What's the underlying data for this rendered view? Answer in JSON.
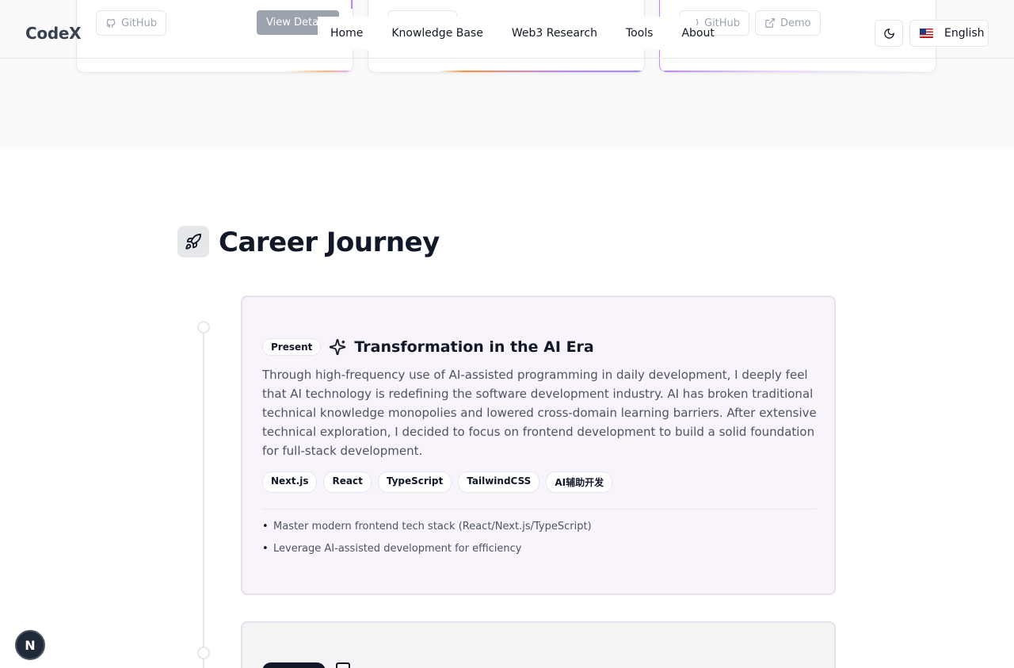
{
  "projects": {
    "card1": {
      "github_label": "GitHub",
      "view_label": "View Details"
    },
    "card3": {
      "github_label": "GitHub",
      "demo_label": "Demo"
    }
  },
  "header": {
    "logo": "CodeX",
    "nav": [
      "Home",
      "Knowledge Base",
      "Web3 Research",
      "Tools",
      "About"
    ],
    "language": "English"
  },
  "section": {
    "title": "Career Journey",
    "icon": "rocket-icon"
  },
  "timeline": [
    {
      "badge": "Present",
      "icon": "sparkles-icon",
      "title": "Transformation in the AI Era",
      "description": "Through high-frequency use of AI-assisted programming in daily development, I deeply feel that AI technology is redefining the software development industry. AI has broken traditional technical knowledge monopolies and lowered cross-domain learning barriers. After extensive technical exploration, I decided to focus on frontend development to build a solid foundation for full-stack development.",
      "tags": [
        "Next.js",
        "React",
        "TypeScript",
        "TailwindCSS",
        "AI辅助开发"
      ],
      "highlights": [
        "Master modern frontend tech stack (React/Next.js/TypeScript)",
        "Leverage AI-assisted development for efficiency"
      ]
    }
  ],
  "floating": {
    "label": "N"
  },
  "colors": {
    "card_bg": "#f9f3fb",
    "accent_purple": "#c084fc",
    "accent_orange": "#fb923c"
  }
}
